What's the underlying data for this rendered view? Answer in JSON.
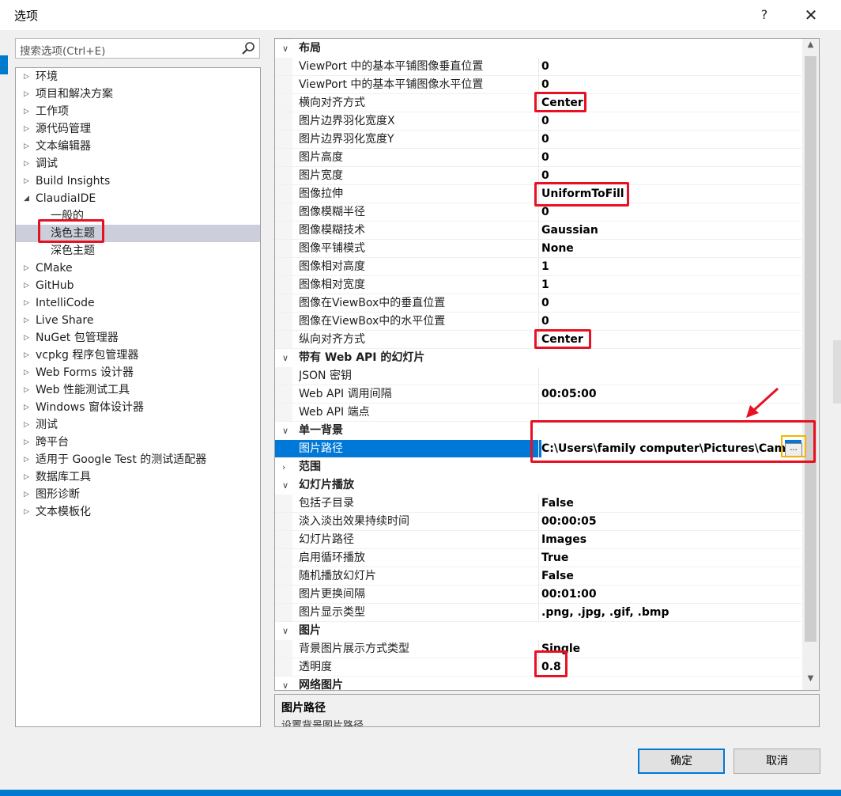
{
  "window": {
    "title": "选项",
    "help_label": "?",
    "close_label": "✕"
  },
  "search": {
    "placeholder": "搜索选项(Ctrl+E)"
  },
  "tree": [
    {
      "label": "环境",
      "arrow": "▷",
      "child": false,
      "selected": false
    },
    {
      "label": "项目和解决方案",
      "arrow": "▷",
      "child": false,
      "selected": false
    },
    {
      "label": "工作项",
      "arrow": "▷",
      "child": false,
      "selected": false
    },
    {
      "label": "源代码管理",
      "arrow": "▷",
      "child": false,
      "selected": false
    },
    {
      "label": "文本编辑器",
      "arrow": "▷",
      "child": false,
      "selected": false
    },
    {
      "label": "调试",
      "arrow": "▷",
      "child": false,
      "selected": false
    },
    {
      "label": "Build Insights",
      "arrow": "▷",
      "child": false,
      "selected": false
    },
    {
      "label": "ClaudiaIDE",
      "arrow": "◢",
      "child": false,
      "selected": false
    },
    {
      "label": "一般的",
      "arrow": "",
      "child": true,
      "selected": false
    },
    {
      "label": "浅色主题",
      "arrow": "",
      "child": true,
      "selected": true
    },
    {
      "label": "深色主题",
      "arrow": "",
      "child": true,
      "selected": false
    },
    {
      "label": "CMake",
      "arrow": "▷",
      "child": false,
      "selected": false
    },
    {
      "label": "GitHub",
      "arrow": "▷",
      "child": false,
      "selected": false
    },
    {
      "label": "IntelliCode",
      "arrow": "▷",
      "child": false,
      "selected": false
    },
    {
      "label": "Live Share",
      "arrow": "▷",
      "child": false,
      "selected": false
    },
    {
      "label": "NuGet 包管理器",
      "arrow": "▷",
      "child": false,
      "selected": false
    },
    {
      "label": "vcpkg 程序包管理器",
      "arrow": "▷",
      "child": false,
      "selected": false
    },
    {
      "label": "Web Forms 设计器",
      "arrow": "▷",
      "child": false,
      "selected": false
    },
    {
      "label": "Web 性能测试工具",
      "arrow": "▷",
      "child": false,
      "selected": false
    },
    {
      "label": "Windows 窗体设计器",
      "arrow": "▷",
      "child": false,
      "selected": false
    },
    {
      "label": "测试",
      "arrow": "▷",
      "child": false,
      "selected": false
    },
    {
      "label": "跨平台",
      "arrow": "▷",
      "child": false,
      "selected": false
    },
    {
      "label": "适用于 Google Test 的测试适配器",
      "arrow": "▷",
      "child": false,
      "selected": false
    },
    {
      "label": "数据库工具",
      "arrow": "▷",
      "child": false,
      "selected": false
    },
    {
      "label": "图形诊断",
      "arrow": "▷",
      "child": false,
      "selected": false
    },
    {
      "label": "文本模板化",
      "arrow": "▷",
      "child": false,
      "selected": false
    }
  ],
  "grid": [
    {
      "type": "cat",
      "name": "布局",
      "chev": "∨"
    },
    {
      "type": "prop",
      "name": "ViewPort 中的基本平铺图像垂直位置",
      "value": "0"
    },
    {
      "type": "prop",
      "name": "ViewPort 中的基本平铺图像水平位置",
      "value": "0"
    },
    {
      "type": "prop",
      "name": "横向对齐方式",
      "value": "Center"
    },
    {
      "type": "prop",
      "name": "图片边界羽化宽度X",
      "value": "0"
    },
    {
      "type": "prop",
      "name": "图片边界羽化宽度Y",
      "value": "0"
    },
    {
      "type": "prop",
      "name": "图片高度",
      "value": "0"
    },
    {
      "type": "prop",
      "name": "图片宽度",
      "value": "0"
    },
    {
      "type": "prop",
      "name": "图像拉伸",
      "value": "UniformToFill"
    },
    {
      "type": "prop",
      "name": "图像模糊半径",
      "value": "0"
    },
    {
      "type": "prop",
      "name": "图像模糊技术",
      "value": "Gaussian"
    },
    {
      "type": "prop",
      "name": "图像平铺模式",
      "value": "None"
    },
    {
      "type": "prop",
      "name": "图像相对高度",
      "value": "1"
    },
    {
      "type": "prop",
      "name": "图像相对宽度",
      "value": "1"
    },
    {
      "type": "prop",
      "name": "图像在ViewBox中的垂直位置",
      "value": "0"
    },
    {
      "type": "prop",
      "name": "图像在ViewBox中的水平位置",
      "value": "0"
    },
    {
      "type": "prop",
      "name": "纵向对齐方式",
      "value": "Center"
    },
    {
      "type": "cat",
      "name": "带有 Web API 的幻灯片",
      "chev": "∨"
    },
    {
      "type": "prop",
      "name": "JSON 密钥",
      "value": ""
    },
    {
      "type": "prop",
      "name": "Web API 调用间隔",
      "value": "00:05:00"
    },
    {
      "type": "prop",
      "name": "Web API 端点",
      "value": ""
    },
    {
      "type": "cat",
      "name": "单一背景",
      "chev": "∨"
    },
    {
      "type": "sel",
      "name": "图片路径",
      "value": "C:\\Users\\family computer\\Pictures\\Camera Roll"
    },
    {
      "type": "cat",
      "name": "范围",
      "chev": "›"
    },
    {
      "type": "cat",
      "name": "幻灯片播放",
      "chev": "∨"
    },
    {
      "type": "prop",
      "name": "包括子目录",
      "value": "False"
    },
    {
      "type": "prop",
      "name": "淡入淡出效果持续时间",
      "value": "00:00:05"
    },
    {
      "type": "prop",
      "name": "幻灯片路径",
      "value": "Images"
    },
    {
      "type": "prop",
      "name": "启用循环播放",
      "value": "True"
    },
    {
      "type": "prop",
      "name": "随机播放幻灯片",
      "value": "False"
    },
    {
      "type": "prop",
      "name": "图片更换间隔",
      "value": "00:01:00"
    },
    {
      "type": "prop",
      "name": "图片显示类型",
      "value": ".png, .jpg, .gif, .bmp"
    },
    {
      "type": "cat",
      "name": "图片",
      "chev": "∨"
    },
    {
      "type": "prop",
      "name": "背景图片展示方式类型",
      "value": "Single"
    },
    {
      "type": "prop",
      "name": "透明度",
      "value": "0.8"
    },
    {
      "type": "cat",
      "name": "网络图片",
      "chev": "∨"
    }
  ],
  "ellipsis_label": "...",
  "description": {
    "title": "图片路径",
    "text": "设置背景图片路径"
  },
  "buttons": {
    "ok": "确定",
    "cancel": "取消"
  },
  "colors": {
    "annotation": "#e81123",
    "highlight": "#f5b400",
    "selection": "#0078d7"
  }
}
